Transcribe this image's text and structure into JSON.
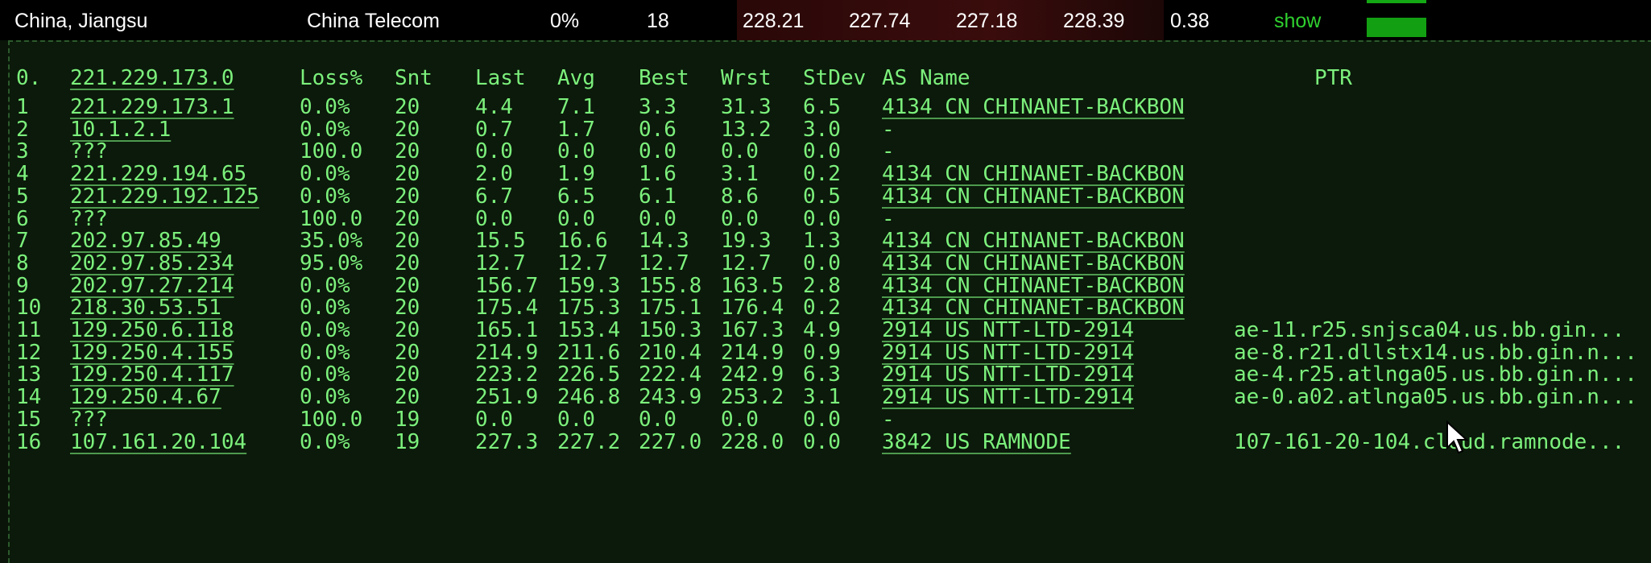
{
  "summary": {
    "location": "China, Jiangsu",
    "isp": "China Telecom",
    "loss": "0%",
    "sent": "18",
    "last": "228.21",
    "avg": "227.74",
    "best": "227.18",
    "worst": "228.39",
    "stdev": "0.38",
    "show_label": "show",
    "accent_color": "#12a012",
    "text_color": "#ffffff"
  },
  "trace": {
    "text_color": "#7cf07c",
    "header": {
      "idx": "0.",
      "host": "221.229.173.0",
      "loss": "Loss%",
      "snt": "Snt",
      "last": "Last",
      "avg": "Avg",
      "best": "Best",
      "wrst": "Wrst",
      "stdev": "StDev",
      "as_name": "AS Name",
      "ptr": "PTR"
    },
    "hops": [
      {
        "idx": "1",
        "host": "221.229.173.1",
        "loss": "0.0%",
        "snt": "20",
        "last": "4.4",
        "avg": "7.1",
        "best": "3.3",
        "wrst": "31.3",
        "stdev": "6.5",
        "as": "4134  CN CHINANET-BACKBON",
        "ptr": ""
      },
      {
        "idx": "2",
        "host": "10.1.2.1",
        "loss": "0.0%",
        "snt": "20",
        "last": "0.7",
        "avg": "1.7",
        "best": "0.6",
        "wrst": "13.2",
        "stdev": "3.0",
        "as": "-",
        "ptr": ""
      },
      {
        "idx": "3",
        "host": "???",
        "loss": "100.0",
        "snt": "20",
        "last": "0.0",
        "avg": "0.0",
        "best": "0.0",
        "wrst": "0.0",
        "stdev": "0.0",
        "as": "-",
        "ptr": ""
      },
      {
        "idx": "4",
        "host": "221.229.194.65",
        "loss": "0.0%",
        "snt": "20",
        "last": "2.0",
        "avg": "1.9",
        "best": "1.6",
        "wrst": "3.1",
        "stdev": "0.2",
        "as": "4134  CN CHINANET-BACKBON",
        "ptr": ""
      },
      {
        "idx": "5",
        "host": "221.229.192.125",
        "loss": "0.0%",
        "snt": "20",
        "last": "6.7",
        "avg": "6.5",
        "best": "6.1",
        "wrst": "8.6",
        "stdev": "0.5",
        "as": "4134  CN CHINANET-BACKBON",
        "ptr": ""
      },
      {
        "idx": "6",
        "host": "???",
        "loss": "100.0",
        "snt": "20",
        "last": "0.0",
        "avg": "0.0",
        "best": "0.0",
        "wrst": "0.0",
        "stdev": "0.0",
        "as": "-",
        "ptr": ""
      },
      {
        "idx": "7",
        "host": "202.97.85.49",
        "loss": "35.0%",
        "snt": "20",
        "last": "15.5",
        "avg": "16.6",
        "best": "14.3",
        "wrst": "19.3",
        "stdev": "1.3",
        "as": "4134  CN CHINANET-BACKBON",
        "ptr": ""
      },
      {
        "idx": "8",
        "host": "202.97.85.234",
        "loss": "95.0%",
        "snt": "20",
        "last": "12.7",
        "avg": "12.7",
        "best": "12.7",
        "wrst": "12.7",
        "stdev": "0.0",
        "as": "4134  CN CHINANET-BACKBON",
        "ptr": ""
      },
      {
        "idx": "9",
        "host": "202.97.27.214",
        "loss": "0.0%",
        "snt": "20",
        "last": "156.7",
        "avg": "159.3",
        "best": "155.8",
        "wrst": "163.5",
        "stdev": "2.8",
        "as": "4134  CN CHINANET-BACKBON",
        "ptr": ""
      },
      {
        "idx": "10",
        "host": "218.30.53.51",
        "loss": "0.0%",
        "snt": "20",
        "last": "175.4",
        "avg": "175.3",
        "best": "175.1",
        "wrst": "176.4",
        "stdev": "0.2",
        "as": "4134  CN CHINANET-BACKBON",
        "ptr": ""
      },
      {
        "idx": "11",
        "host": "129.250.6.118",
        "loss": "0.0%",
        "snt": "20",
        "last": "165.1",
        "avg": "153.4",
        "best": "150.3",
        "wrst": "167.3",
        "stdev": "4.9",
        "as": "2914  US NTT-LTD-2914",
        "ptr": "ae-11.r25.snjsca04.us.bb.gin..."
      },
      {
        "idx": "12",
        "host": "129.250.4.155",
        "loss": "0.0%",
        "snt": "20",
        "last": "214.9",
        "avg": "211.6",
        "best": "210.4",
        "wrst": "214.9",
        "stdev": "0.9",
        "as": "2914  US NTT-LTD-2914",
        "ptr": "ae-8.r21.dllstx14.us.bb.gin.n..."
      },
      {
        "idx": "13",
        "host": "129.250.4.117",
        "loss": "0.0%",
        "snt": "20",
        "last": "223.2",
        "avg": "226.5",
        "best": "222.4",
        "wrst": "242.9",
        "stdev": "6.3",
        "as": "2914  US NTT-LTD-2914",
        "ptr": "ae-4.r25.atlnga05.us.bb.gin.n..."
      },
      {
        "idx": "14",
        "host": "129.250.4.67",
        "loss": "0.0%",
        "snt": "20",
        "last": "251.9",
        "avg": "246.8",
        "best": "243.9",
        "wrst": "253.2",
        "stdev": "3.1",
        "as": "2914  US NTT-LTD-2914",
        "ptr": "ae-0.a02.atlnga05.us.bb.gin.n..."
      },
      {
        "idx": "15",
        "host": "???",
        "loss": "100.0",
        "snt": "19",
        "last": "0.0",
        "avg": "0.0",
        "best": "0.0",
        "wrst": "0.0",
        "stdev": "0.0",
        "as": "-",
        "ptr": ""
      },
      {
        "idx": "16",
        "host": "107.161.20.104",
        "loss": "0.0%",
        "snt": "19",
        "last": "227.3",
        "avg": "227.2",
        "best": "227.0",
        "wrst": "228.0",
        "stdev": "0.0",
        "as": "3842  US RAMNODE",
        "ptr": "107-161-20-104.cloud.ramnode..."
      }
    ]
  }
}
